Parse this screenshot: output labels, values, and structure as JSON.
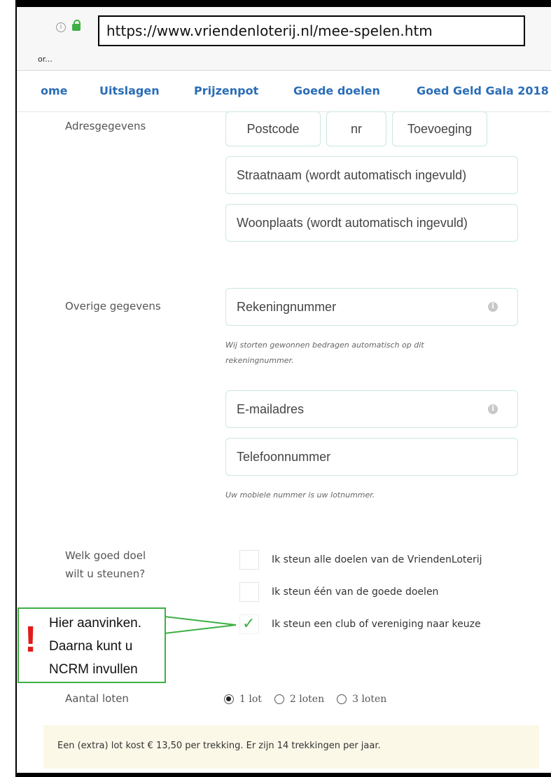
{
  "browser": {
    "url": "https://www.vriendenloterij.nl/mee-spelen.htm",
    "bookmark": "or...",
    "info_glyph": "i"
  },
  "nav": {
    "items": [
      {
        "label": "ome"
      },
      {
        "label": "Uitslagen"
      },
      {
        "label": "Prijzenpot"
      },
      {
        "label": "Goede doelen"
      },
      {
        "label": "Goed Geld Gala 2018"
      }
    ]
  },
  "address": {
    "label": "Adresgegevens",
    "postcode_placeholder": "Postcode",
    "number_placeholder": "nr",
    "addition_placeholder": "Toevoeging",
    "street_placeholder": "Straatnaam (wordt automatisch ingevuld)",
    "city_placeholder": "Woonplaats (wordt automatisch ingevuld)"
  },
  "other": {
    "label": "Overige gegevens",
    "account_placeholder": "Rekeningnummer",
    "account_hint_line1": "Wij storten gewonnen bedragen automatisch op dit",
    "account_hint_line2": "rekeningnummer.",
    "email_placeholder": "E-mailadres",
    "phone_placeholder": "Telefoonnummer",
    "phone_hint": "Uw mobiele nummer is uw lotnummer.",
    "info_glyph": "i"
  },
  "charity": {
    "label_line1": "Welk goed doel",
    "label_line2": "wilt u steunen?",
    "options": [
      {
        "label": "Ik steun alle doelen van de VriendenLoterij",
        "checked": false
      },
      {
        "label": "Ik steun één van de goede doelen",
        "checked": false
      },
      {
        "label": "Ik steun een club of vereniging naar keuze",
        "checked": true
      }
    ],
    "check_glyph": "✓"
  },
  "callout": {
    "mark": "!",
    "line1": "Hier aanvinken.",
    "line2": "Daarna kunt u",
    "line3": "NCRM invullen",
    "border_color": "#3cb043",
    "mark_color": "#e21a1a"
  },
  "tickets": {
    "label": "Aantal loten",
    "options": [
      {
        "label": "1 lot",
        "selected": true
      },
      {
        "label": "2 loten",
        "selected": false
      },
      {
        "label": "3 loten",
        "selected": false
      }
    ]
  },
  "price_notice": "Een (extra) lot kost € 13,50 per trekking. Er zijn 14 trekkingen per jaar.",
  "colors": {
    "nav_link": "#2a6db7",
    "field_border": "#c9e8e1",
    "banner_bg": "#fcf8e8",
    "checkmark": "#3cb043"
  }
}
